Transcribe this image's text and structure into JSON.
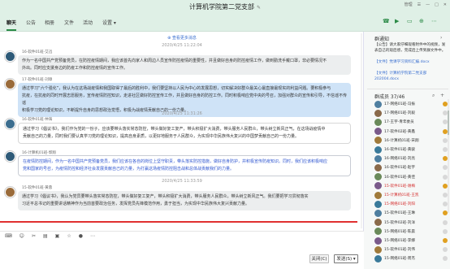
{
  "window": {
    "title": "计算机学院第二党支部",
    "user": "管理",
    "edit_icon": "pencil-icon"
  },
  "tabs": [
    {
      "label": "聊天"
    },
    {
      "label": "公告"
    },
    {
      "label": "相册"
    },
    {
      "label": "文件"
    },
    {
      "label": "活动"
    },
    {
      "label": "设置 ▾"
    }
  ],
  "chat": {
    "load_more": "⊕ 查看更多消息",
    "messages": [
      {
        "time": "2020/4/25 11:22:04",
        "sender": "16-软件01班-艾迅",
        "lines": [
          "作为一名中国共产党预备党员，在防控疫情期间，我应该首先向家人和周边人员宣传防控疫情的重要性，并且做好自身的防控疫情工作，做到勤洗手戴口罩，非必要情况不",
          "外出。同时应支援身边的防疫工作和防控疫情的宣传工作。"
        ]
      },
      {
        "sender": "17-软件01班-刘璋",
        "lines": [
          "通过学习“六个强化”，我认为在这场战疫情和我国取得了最后的胜利中，我们要坚持以人民为中心的发展思想，切实解决好群众最关心最直接最现实的利益问题。要积极参与",
          "抗疫，在抗疫的同时开展志愿服务，宣传疫情防控知识，走进社区做好防控宣传工作，并且做好自身的防控工作。同时积极响应党中央的号召，加强对群众的宣传和引导，不信谣不传谣",
          "积极学习党的理论知识，不断提升自身的思想政治觉悟，积极为战疫情贡献自己的一份力量。"
        ]
      },
      {
        "time": "2020/4/25 11:31:26",
        "sender": "16-软件01班-仲海",
        "lines": [
          "通过学习《倡议书》，我们作为党的一份子，应该要带头落实常态防控，带头做好复工复产，带头积极扩大消费，带头服务人民群众，带头树立新风正气，在这场战疫情中",
          "贡献自己的力量，同时我们要认真学习党的理论知识，提高自身素质，以更好地服务于人民群众，为实现中华民族伟大复兴的中国梦贡献自己的一份力量。"
        ]
      },
      {
        "sender": "16-计算机01班-郭翔",
        "lines": [
          "在疫情防控期间，作为一名中国共产党预备党员，我们应该在各自的岗位上坚守职责，带头落实防控措施，做好自身防护，并积极宣传防疫知识。同时，我们应该积极响应",
          "党和国家的号召，为疫情防控和经济社会发展贡献自己的力量，为打赢这场疫情防控阻击战和总体战贡献我们的力量。"
        ]
      },
      {
        "time": "2020/4/25 11:33:59",
        "sender": "15-软件01班-黄蓉",
        "lines": [
          "通过学习《倡议书》，我认为党员要带头落实常态防控，带头做好复工复产，带头积极扩大消费，带头服务人民群众，带头树立新风正气。我们要把学习贯彻落实",
          "习近平总书记的重要讲话精神作为当前首要政治任务，发挥党员先锋模范作用，勇于担当，为实现中华民族伟大复兴贡献力量。"
        ]
      }
    ]
  },
  "toolbar": {
    "icons": [
      "keyboard-icon",
      "emoji-icon",
      "scissors-icon",
      "folder-icon",
      "image-icon",
      "star-icon",
      "more-icon"
    ]
  },
  "buttons": {
    "close": "关闭(C)",
    "send": "发送(S)",
    "send_arrow": "▾"
  },
  "right_panel": {
    "notice_title": "群通知",
    "notices": [
      "【公告】请大家仔细观看附件中的视频，发表自己的观后感，完成后上传到群文件中。",
      "【文件】党课学习资料汇编.docx",
      "【文件】计算机学院第二党支部202004.docx"
    ],
    "members_title": "群成员 37/46",
    "members": [
      {
        "name": "17-网络01班-冯振",
        "color": "normal"
      },
      {
        "name": "17-网络01班-刘毅",
        "color": "normal"
      },
      {
        "name": "17-王宇-青年委员",
        "color": "normal"
      },
      {
        "name": "17-软件02班-黄鑫",
        "color": "normal"
      },
      {
        "name": "16-计算机01班-宋翔",
        "color": "normal"
      },
      {
        "name": "16-软件01班-黄骏",
        "color": "normal"
      },
      {
        "name": "16-网络01班-刘亮",
        "color": "normal"
      },
      {
        "name": "16-软件01班-赵宇",
        "color": "normal"
      },
      {
        "name": "16-软件01班-黄佳",
        "color": "normal"
      },
      {
        "name": "15-软件01班-谢梅",
        "color": "red"
      },
      {
        "name": "15-计算机01班-王凯",
        "color": "red"
      },
      {
        "name": "15-网络01班-刘阳",
        "color": "red"
      },
      {
        "name": "15-软件01班-王琳",
        "color": "normal"
      },
      {
        "name": "15-软件02班-刘洋",
        "color": "normal"
      },
      {
        "name": "15-网络01班-陈晨",
        "color": "normal"
      },
      {
        "name": "15-网络01班-李娜",
        "color": "normal"
      },
      {
        "name": "15-软件01班-刘伟",
        "color": "normal"
      },
      {
        "name": "15-网络01班-周杰",
        "color": "normal"
      }
    ]
  },
  "colors": {
    "accent": "#2a8a46",
    "title_bg": "#dff0e6",
    "highlight_blue": "#2f56d0",
    "red_line": "#e03030"
  }
}
